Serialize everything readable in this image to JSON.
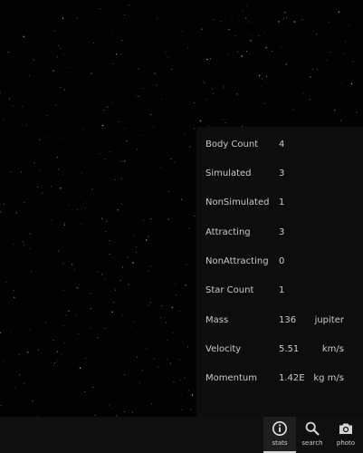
{
  "stats": [
    {
      "label": "Body Count",
      "value": "4",
      "unit": ""
    },
    {
      "label": "Simulated",
      "value": "3",
      "unit": ""
    },
    {
      "label": "NonSimulated",
      "value": "1",
      "unit": ""
    },
    {
      "label": "Attracting",
      "value": "3",
      "unit": ""
    },
    {
      "label": "NonAttracting",
      "value": "0",
      "unit": ""
    },
    {
      "label": "Star Count",
      "value": "1",
      "unit": ""
    },
    {
      "label": "Mass",
      "value": "136",
      "unit": "jupiter"
    },
    {
      "label": "Velocity",
      "value": "5.51",
      "unit": "km/s"
    },
    {
      "label": "Momentum",
      "value": "1.42E",
      "unit": "kg m/s"
    }
  ],
  "nav": {
    "stats": {
      "label": "stats",
      "icon": "info-icon",
      "active": true
    },
    "search": {
      "label": "search",
      "icon": "search-icon",
      "active": false
    },
    "photo": {
      "label": "photo",
      "icon": "camera-icon",
      "active": false
    }
  },
  "colors": {
    "background": "#020202",
    "panel": "#0d0d0d",
    "text": "#c9c9c9",
    "bar": "#0f0f0f"
  }
}
